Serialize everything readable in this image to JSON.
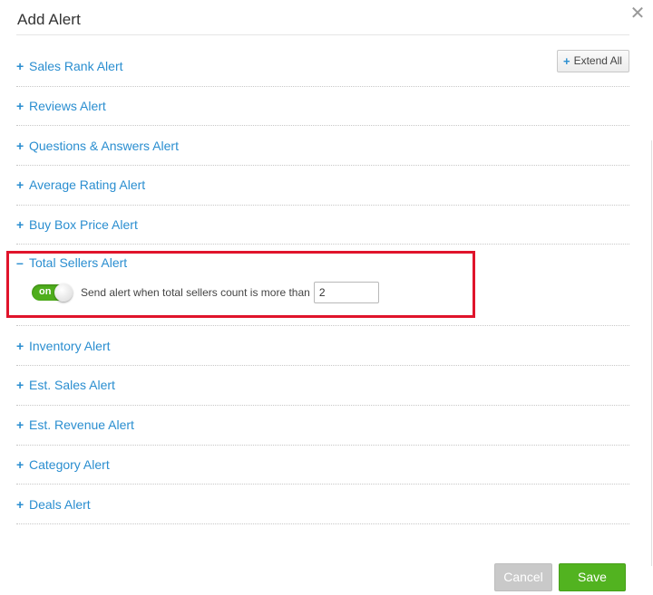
{
  "dialog": {
    "title": "Add Alert",
    "close_icon": "close-icon",
    "extend_label": "Extend All",
    "extend_icon": "plus-icon"
  },
  "alerts": [
    {
      "label": "Sales Rank Alert",
      "expanded": false,
      "sign": "+"
    },
    {
      "label": "Reviews Alert",
      "expanded": false,
      "sign": "+"
    },
    {
      "label": "Questions & Answers Alert",
      "expanded": false,
      "sign": "+"
    },
    {
      "label": "Average Rating Alert",
      "expanded": false,
      "sign": "+"
    },
    {
      "label": "Buy Box Price Alert",
      "expanded": false,
      "sign": "+"
    },
    {
      "label": "Total Sellers Alert",
      "expanded": true,
      "sign": "–"
    },
    {
      "label": "Inventory Alert",
      "expanded": false,
      "sign": "+"
    },
    {
      "label": "Est. Sales Alert",
      "expanded": false,
      "sign": "+"
    },
    {
      "label": "Est. Revenue Alert",
      "expanded": false,
      "sign": "+"
    },
    {
      "label": "Category Alert",
      "expanded": false,
      "sign": "+"
    },
    {
      "label": "Deals Alert",
      "expanded": false,
      "sign": "+"
    }
  ],
  "total_sellers": {
    "switch_label": "on",
    "switch_state": "on",
    "description": "Send alert when total sellers count is more than",
    "count_value": "2"
  },
  "footer": {
    "cancel_label": "Cancel",
    "save_label": "Save"
  },
  "colors": {
    "link": "#2a8ed0",
    "switch_on": "#4fae1c",
    "save": "#52b320",
    "cancel": "#c9c9c9",
    "highlight": "#e0142b"
  }
}
